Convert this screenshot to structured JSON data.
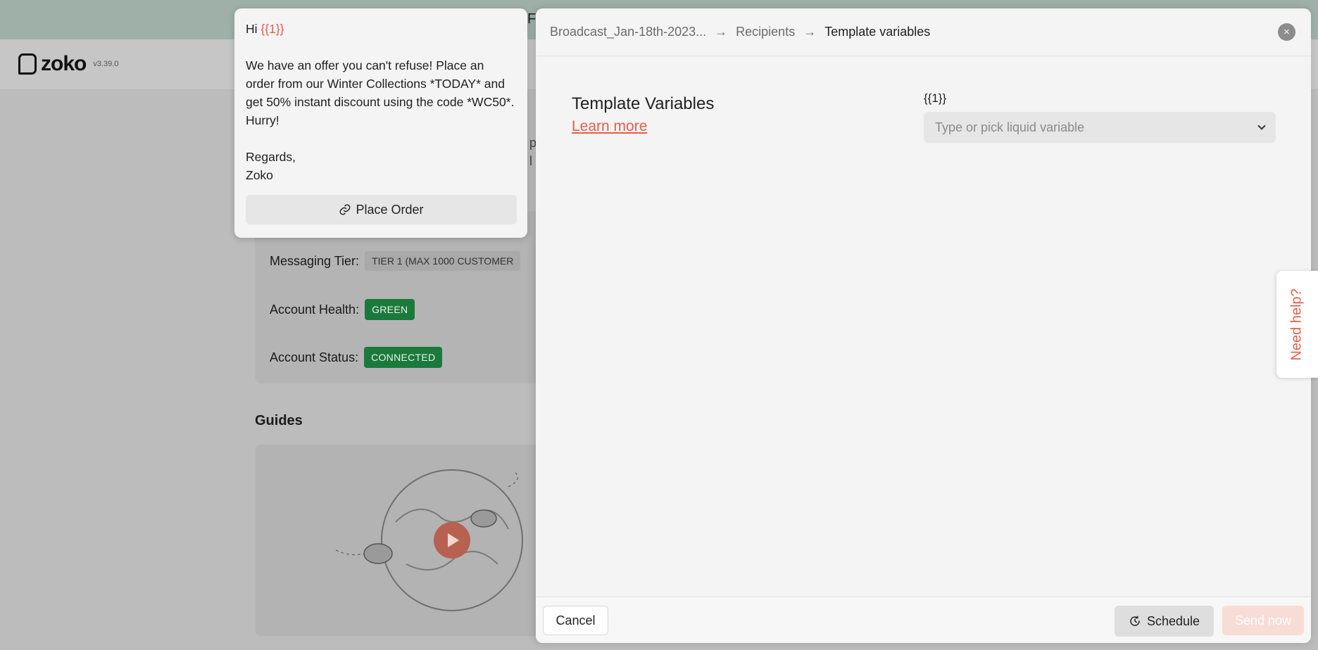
{
  "app": {
    "name": "zoko",
    "version": "v3.39.0"
  },
  "background": {
    "messaging_tier_label": "Messaging Tier:",
    "messaging_tier_value": "TIER 1 (MAX 1000 CUSTOMER",
    "account_health_label": "Account Health:",
    "account_health_value": "GREEN",
    "account_status_label": "Account Status:",
    "account_status_value": "CONNECTED",
    "guides_title": "Guides",
    "top_peek_letter": "F",
    "side_peek_1": "p",
    "side_peek_2": "l"
  },
  "preview": {
    "greeting": "Hi ",
    "greeting_var": "{{1}}",
    "body": "We have an offer you can't refuse! Place an order from our Winter Collections  *TODAY* and get 50% instant discount using the code *WC50*. Hurry!",
    "sign_off": "Regards,",
    "sign_name": "Zoko",
    "button_label": "Place Order"
  },
  "drawer": {
    "breadcrumb": [
      "Broadcast_Jan-18th-2023...",
      "Recipients",
      "Template variables"
    ],
    "title": "Template Variables",
    "learn_more": "Learn more",
    "variable_label": "{{1}}",
    "variable_placeholder": "Type or pick liquid variable",
    "cancel_label": "Cancel",
    "schedule_label": "Schedule",
    "send_label": "Send now",
    "close_symbol": "×"
  },
  "help": {
    "label": "Need help?"
  },
  "colors": {
    "accent": "#e85c47",
    "status_green": "#1a7a3c"
  },
  "icons": [
    "link-icon",
    "clock-icon",
    "close-icon",
    "chevron-down-icon",
    "play-icon"
  ]
}
